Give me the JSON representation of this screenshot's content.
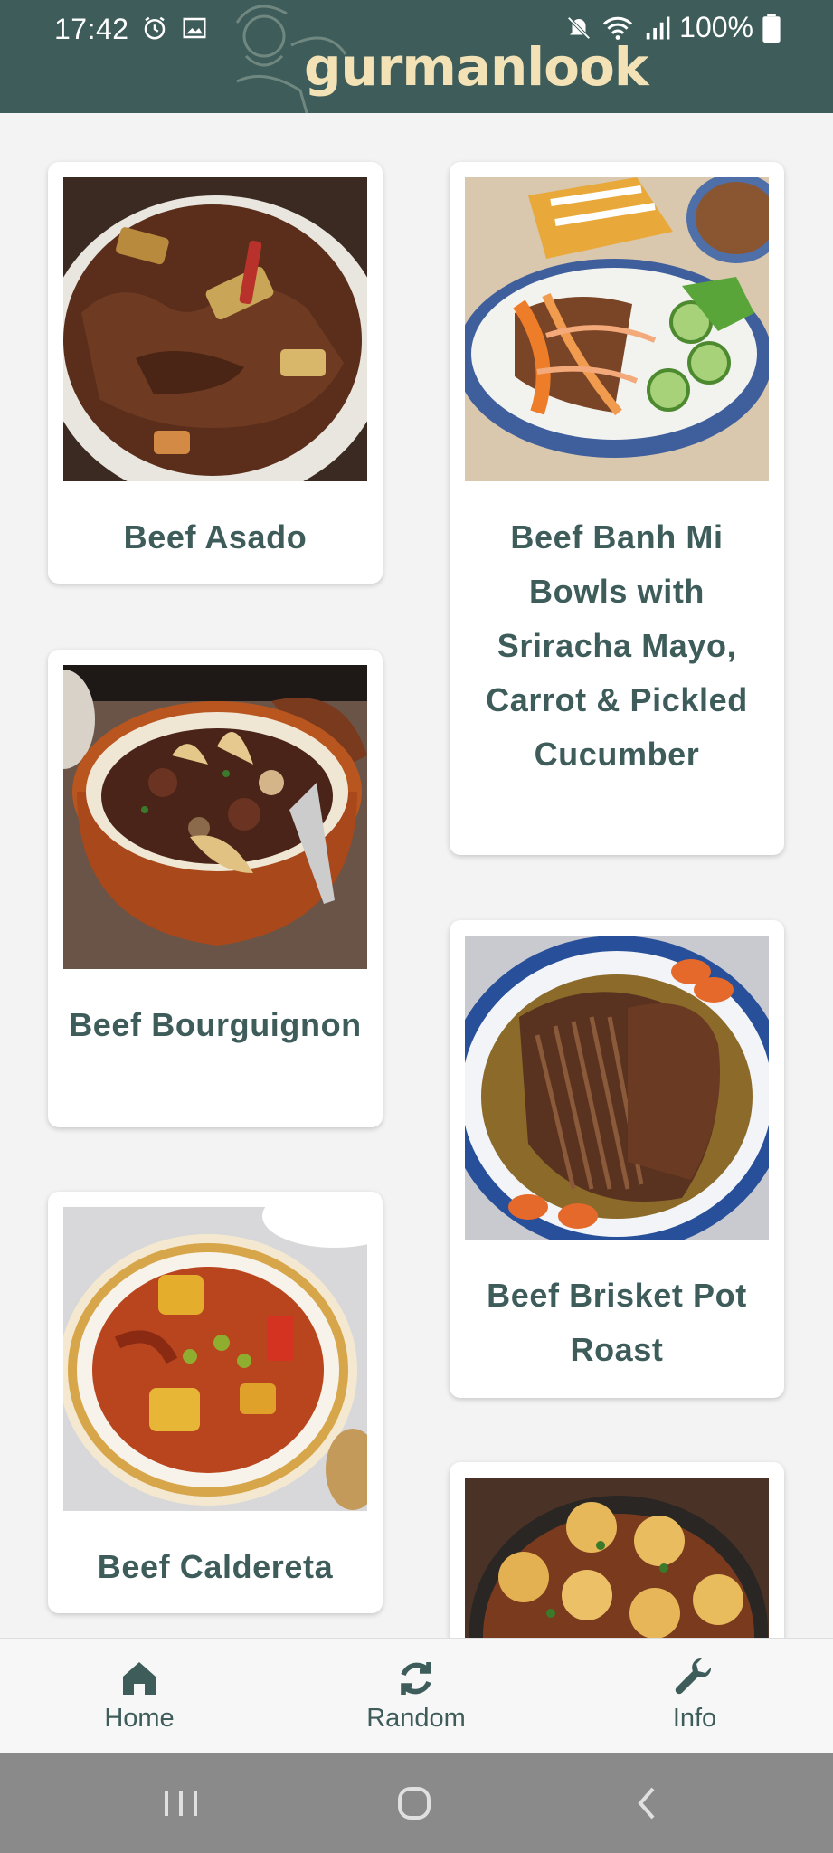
{
  "status_bar": {
    "time": "17:42",
    "battery": "100%",
    "icons": [
      "alarm-icon",
      "image-icon",
      "mute-icon",
      "wifi-icon",
      "signal-icon",
      "battery-icon"
    ]
  },
  "app": {
    "logo": "gurmanlook",
    "accent": "#3d5c5a",
    "logo_color": "#f3e2b5"
  },
  "recipes": [
    {
      "title": "Beef Asado"
    },
    {
      "title": "Beef Banh Mi Bowls with Sriracha Mayo, Carrot & Pickled Cucumber"
    },
    {
      "title": "Beef Bourguignon"
    },
    {
      "title": "Beef Brisket Pot Roast"
    },
    {
      "title": "Beef Caldereta"
    },
    {
      "title": ""
    }
  ],
  "bottom_nav": {
    "items": [
      {
        "label": "Home",
        "icon": "home-icon"
      },
      {
        "label": "Random",
        "icon": "refresh-icon"
      },
      {
        "label": "Info",
        "icon": "wrench-icon"
      }
    ]
  },
  "system_nav": {
    "icons": [
      "recent-apps-icon",
      "home-circle-icon",
      "back-icon"
    ]
  }
}
